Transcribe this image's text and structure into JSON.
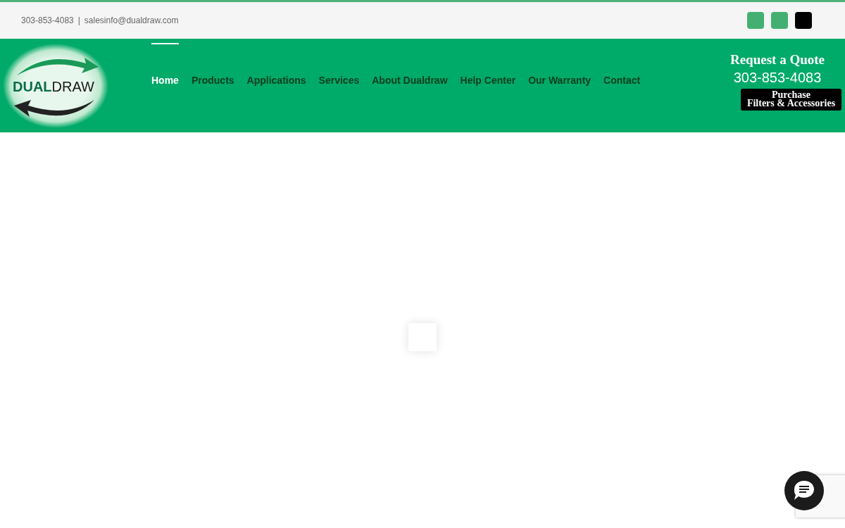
{
  "top_bar": {
    "phone": "303-853-4083",
    "separator": "|",
    "email": "salesinfo@dualdraw.com",
    "social_icons": [
      {
        "color": "#43b072"
      },
      {
        "color": "#43b072"
      },
      {
        "color": "#000000"
      }
    ]
  },
  "header": {
    "logo": {
      "text_bold": "DUAL",
      "text_outline": "DRAW"
    },
    "nav": [
      {
        "label": "Home",
        "selected": true
      },
      {
        "label": "Products",
        "selected": false
      },
      {
        "label": "Applications",
        "selected": false
      },
      {
        "label": "Services",
        "selected": false
      },
      {
        "label": "About Dualdraw",
        "selected": false
      },
      {
        "label": "Help Center",
        "selected": false
      },
      {
        "label": "Our Warranty",
        "selected": false
      },
      {
        "label": "Contact",
        "selected": false
      }
    ],
    "quote": {
      "title": "Request a Quote",
      "phone": "303-853-4083",
      "button": [
        "Purchase",
        "Filters & Accessories"
      ]
    }
  }
}
